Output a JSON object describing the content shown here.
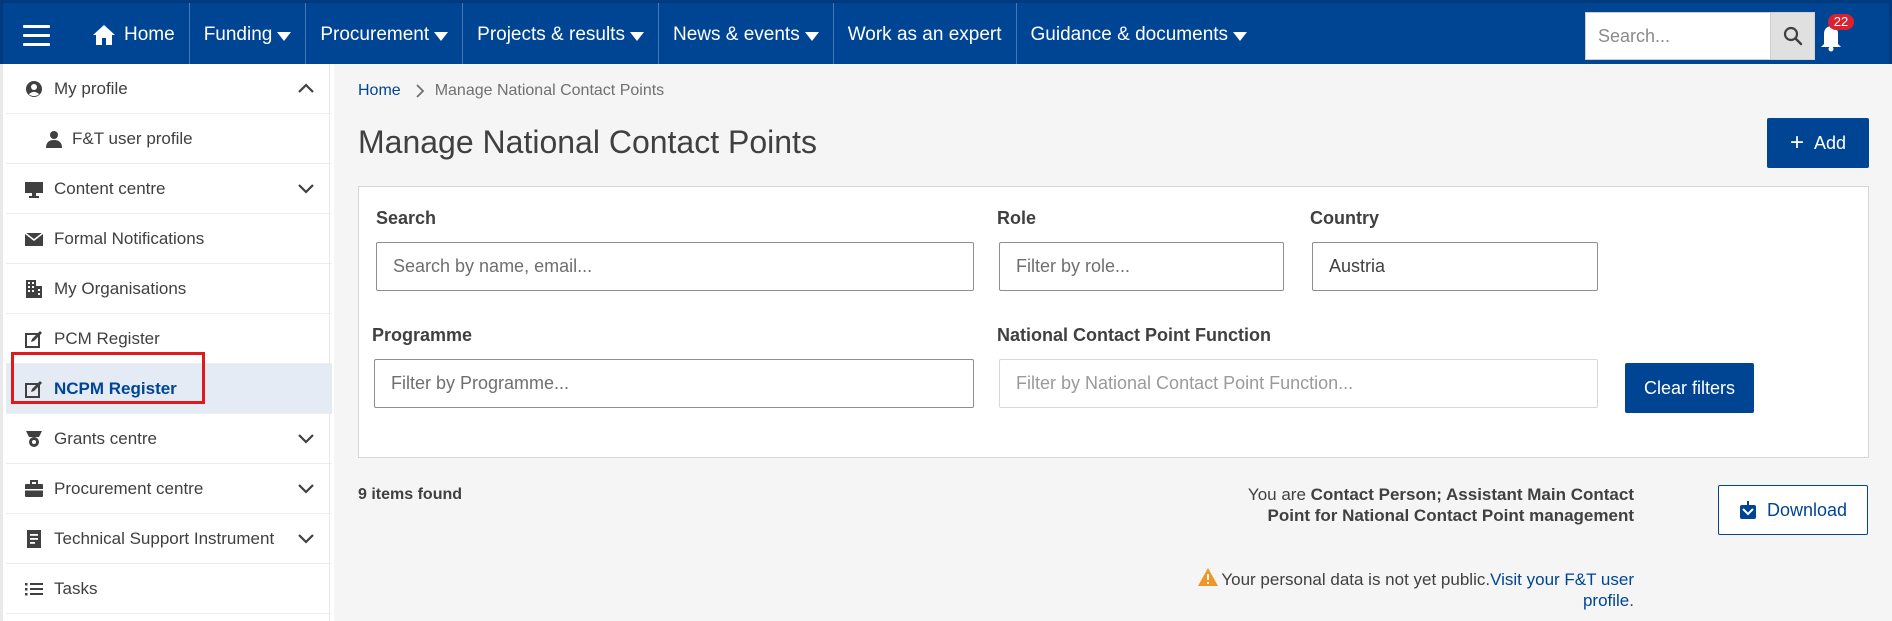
{
  "topbar": {
    "nav": [
      {
        "label": "Home",
        "icon": "home-icon",
        "dropdown": false
      },
      {
        "label": "Funding",
        "dropdown": true
      },
      {
        "label": "Procurement",
        "dropdown": true
      },
      {
        "label": "Projects & results",
        "dropdown": true
      },
      {
        "label": "News & events",
        "dropdown": true
      },
      {
        "label": "Work as an expert",
        "dropdown": false
      },
      {
        "label": "Guidance & documents",
        "dropdown": true
      }
    ],
    "search_placeholder": "Search...",
    "notification_count": "22",
    "colors": {
      "bar": "#004494",
      "badge": "#da2131"
    }
  },
  "sidebar": {
    "items": [
      {
        "label": "My profile",
        "icon": "user-circle-icon",
        "chevron": "up"
      },
      {
        "label": "F&T user profile",
        "icon": "person-icon",
        "sub": true
      },
      {
        "label": "Content centre",
        "icon": "monitor-icon",
        "chevron": "down"
      },
      {
        "label": "Formal Notifications",
        "icon": "envelope-icon"
      },
      {
        "label": "My Organisations",
        "icon": "building-icon"
      },
      {
        "label": "PCM Register",
        "icon": "edit-square-icon"
      },
      {
        "label": "NCPM Register",
        "icon": "edit-square-icon",
        "active": true
      },
      {
        "label": "Grants centre",
        "icon": "grants-icon",
        "chevron": "down"
      },
      {
        "label": "Procurement centre",
        "icon": "briefcase-icon",
        "chevron": "down"
      },
      {
        "label": "Technical Support Instrument",
        "icon": "document-icon",
        "chevron": "down"
      },
      {
        "label": "Tasks",
        "icon": "list-icon"
      }
    ]
  },
  "main": {
    "breadcrumb": {
      "home": "Home",
      "current": "Manage National Contact Points"
    },
    "title": "Manage National Contact Points",
    "add_label": "Add",
    "filters": {
      "search_label": "Search",
      "search_placeholder": "Search by name, email...",
      "role_label": "Role",
      "role_placeholder": "Filter by role...",
      "country_label": "Country",
      "country_value": "Austria",
      "programme_label": "Programme",
      "programme_placeholder": "Filter by Programme...",
      "ncp_function_label": "National Contact Point Function",
      "ncp_function_placeholder": "Filter by National Contact Point Function...",
      "clear_label": "Clear filters"
    },
    "items_found": "9 items found",
    "role_prefix": "You are",
    "role_value": "Contact Person; Assistant Main Contact Point for National Contact Point management",
    "warning_text": "Your personal data is not yet public.",
    "warning_link": "Visit your F&T user profile",
    "warning_suffix": ".",
    "download_label": "Download"
  }
}
